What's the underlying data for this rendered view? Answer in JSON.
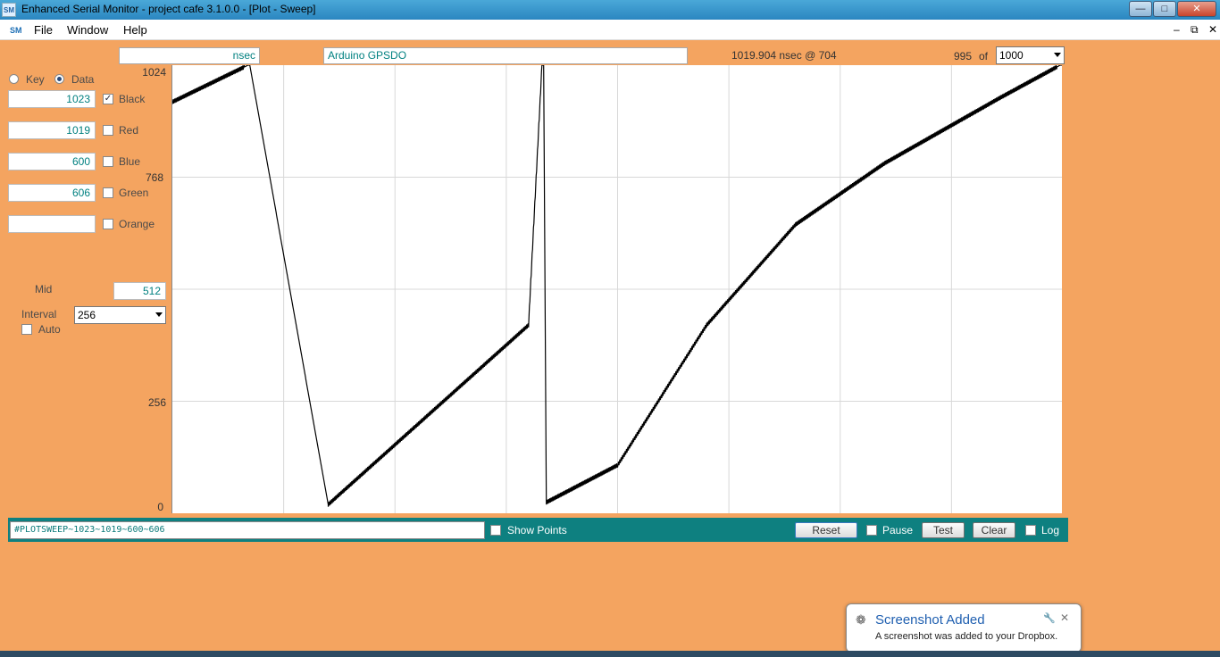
{
  "window": {
    "title": "Enhanced Serial Monitor - project cafe 3.1.0.0 - [Plot - Sweep]",
    "app_icon": "SM"
  },
  "menu": {
    "items": [
      "File",
      "Window",
      "Help"
    ],
    "icon": "SM"
  },
  "top": {
    "units_box": "nsec",
    "title_box": "Arduino GPSDO",
    "readout": "1019.904 nsec @ 704",
    "position": "995",
    "of_label": "of",
    "total_select": "1000"
  },
  "left_panel": {
    "mode": {
      "key_label": "Key",
      "data_label": "Data",
      "selected": "Data"
    },
    "channels": [
      {
        "value": "1023",
        "label": "Black",
        "checked": true
      },
      {
        "value": "1019",
        "label": "Red",
        "checked": false
      },
      {
        "value": "600",
        "label": "Blue",
        "checked": false
      },
      {
        "value": "606",
        "label": "Green",
        "checked": false
      },
      {
        "value": "",
        "label": "Orange",
        "checked": false
      }
    ],
    "mid_label": "Mid",
    "mid_value": "512",
    "interval_label": "Interval",
    "interval_value": "256",
    "auto_label": "Auto"
  },
  "chart_data": {
    "type": "line",
    "ylim": [
      0,
      1024
    ],
    "y_ticks": [
      "1024",
      "768",
      "256",
      "0"
    ],
    "x_range": [
      0,
      1000
    ],
    "grid": true,
    "series": [
      {
        "color": "#000000",
        "x": [
          0,
          85,
          87,
          175,
          400,
          415,
          417,
          420,
          500,
          600,
          700,
          800,
          930,
          997,
          1000
        ],
        "y": [
          940,
          1024,
          1024,
          20,
          430,
          1024,
          1024,
          25,
          110,
          430,
          660,
          800,
          950,
          1024,
          1024
        ]
      }
    ]
  },
  "bottom": {
    "command": "#PLOTSWEEP~1023~1019~600~606",
    "show_points_label": "Show Points",
    "reset_label": "Reset",
    "pause_label": "Pause",
    "test_label": "Test",
    "clear_label": "Clear",
    "log_label": "Log"
  },
  "toast": {
    "title": "Screenshot Added",
    "message": "A screenshot was added to your Dropbox."
  },
  "colors": {
    "background": "#f4a460",
    "bar": "#0e8080",
    "accent": "#008080"
  }
}
